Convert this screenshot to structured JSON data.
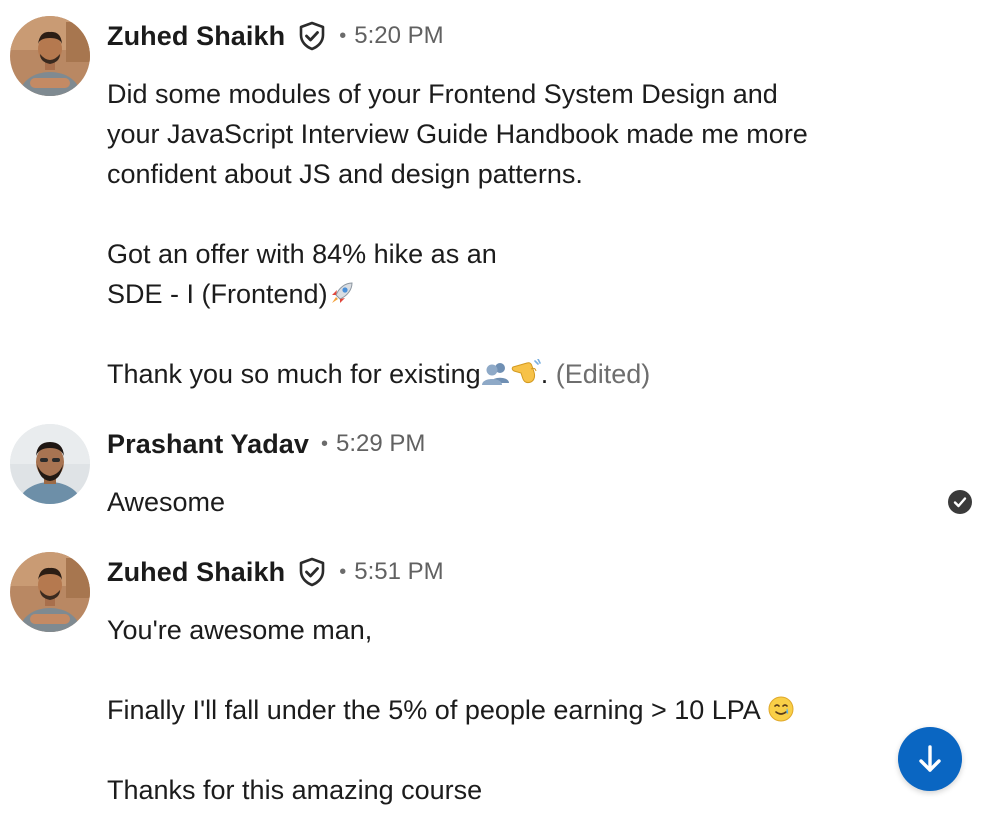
{
  "messages": [
    {
      "author": "Zuhed Shaikh",
      "verified": true,
      "separator": "•",
      "time": "5:20 PM",
      "lines": [
        "Did some modules of your Frontend System Design and",
        "your JavaScript Interview Guide Handbook made me more",
        "confident about JS and design patterns.",
        "",
        "Got an offer with 84% hike as an",
        "SDE - I (Frontend)",
        "",
        "Thank you so much for existing"
      ],
      "line6_emoji": "rocket-emoji",
      "last_line_emojis": [
        "busts-in-silhouette-emoji",
        "saluting-hand-emoji"
      ],
      "last_line_suffix": ".",
      "edited_label": "(Edited)"
    },
    {
      "author": "Prashant Yadav",
      "separator": "•",
      "time": "5:29 PM",
      "lines": [
        "Awesome"
      ]
    },
    {
      "author": "Zuhed Shaikh",
      "verified": true,
      "separator": "•",
      "time": "5:51 PM",
      "lines": [
        "You're awesome man,",
        "",
        "Finally I'll fall under the 5% of people earning > 10 LPA",
        "",
        "Thanks for this amazing course"
      ],
      "line3_emoji": "smiling-face-with-tear-emoji"
    }
  ],
  "icons": {
    "verified": "verified-shield-icon",
    "read_receipt": "read-receipt-check-icon",
    "scroll_down": "arrow-down-icon"
  },
  "colors": {
    "accent": "#0a66c2",
    "timestamp": "#616161",
    "edited": "#6e6e6e",
    "text": "#1c1c1c"
  }
}
